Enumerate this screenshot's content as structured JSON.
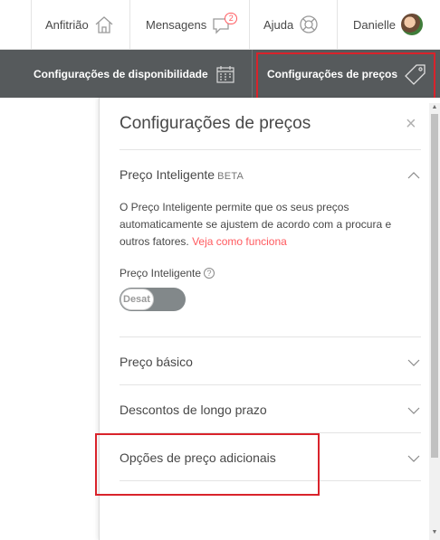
{
  "topnav": {
    "host_label": "Anfitrião",
    "messages_label": "Mensagens",
    "messages_badge": "2",
    "help_label": "Ajuda",
    "user_label": "Danielle"
  },
  "subnav": {
    "availability_label": "Configurações de disponibilidade",
    "pricing_label": "Configurações de preços"
  },
  "panel": {
    "title": "Configurações de preços",
    "close_glyph": "×",
    "smart_pricing": {
      "title": "Preço Inteligente",
      "beta": "BETA",
      "description": "O Preço Inteligente permite que os seus preços automaticamente se ajustem de acordo com a procura e outros fatores.",
      "link": "Veja como funciona",
      "toggle_label": "Preço Inteligente",
      "toggle_state": "Desat"
    },
    "sections": [
      {
        "title": "Preço básico"
      },
      {
        "title": "Descontos de longo prazo"
      },
      {
        "title": "Opções de preço adicionais"
      }
    ]
  },
  "colors": {
    "accent": "#ff5a5f",
    "subnav_bg": "#565a5c",
    "highlight": "#d9232b"
  }
}
